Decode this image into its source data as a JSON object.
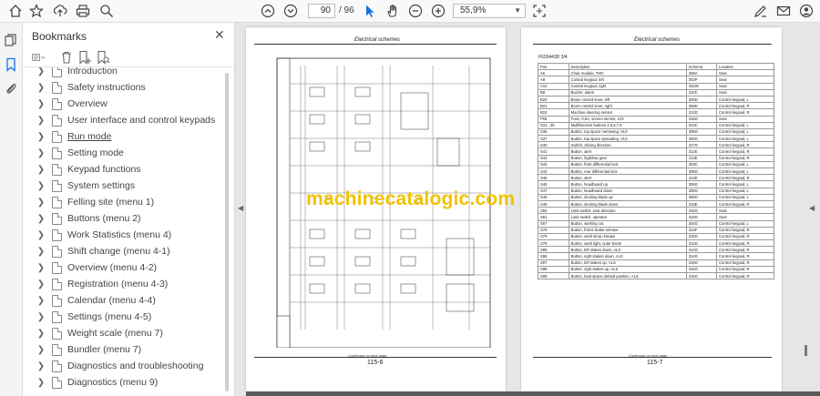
{
  "toolbar": {
    "current_page": "90",
    "total_pages": "/ 96",
    "zoom": "55,9%",
    "icons": [
      "home-icon",
      "bookmark-star-icon",
      "upload-icon",
      "print-icon",
      "search-icon",
      "page-up-icon",
      "page-down-icon",
      "select-cursor-icon",
      "hand-icon",
      "zoom-out-icon",
      "zoom-in-icon",
      "fit-page-icon",
      "sign-icon",
      "email-icon",
      "account-icon"
    ]
  },
  "sidebar": {
    "title": "Bookmarks",
    "items": [
      {
        "label": "Introduction"
      },
      {
        "label": "Safety instructions"
      },
      {
        "label": "Overview"
      },
      {
        "label": "User interface and control keypads"
      },
      {
        "label": "Run mode"
      },
      {
        "label": "Setting mode"
      },
      {
        "label": "Keypad functions"
      },
      {
        "label": "System settings"
      },
      {
        "label": "Felling site (menu 1)"
      },
      {
        "label": "Buttons (menu 2)"
      },
      {
        "label": "Work Statistics (menu 4)"
      },
      {
        "label": "Shift change (menu 4-1)"
      },
      {
        "label": "Overview (menu 4-2)"
      },
      {
        "label": "Registration (menu 4-3)"
      },
      {
        "label": "Calendar (menu 4-4)"
      },
      {
        "label": "Settings (menu 4-5)"
      },
      {
        "label": "Weight scale (menu 7)"
      },
      {
        "label": "Bundler (menu 7)"
      },
      {
        "label": "Diagnostics and troubleshooting"
      },
      {
        "label": "Diagnostics (menu 9)"
      }
    ]
  },
  "document": {
    "left_page": {
      "header": "Electrical schemes",
      "page_number": "115-6",
      "footer_note": "Continued on next page",
      "code": "F626443D 1/4"
    },
    "right_page": {
      "header": "Electrical schemes",
      "page_number": "115-7",
      "footer_note": "Continued on next page",
      "table_title": "F626443D 3/4",
      "columns": [
        "Pos",
        "Description",
        "Schema",
        "Location"
      ],
      "rows": [
        [
          "A6",
          "Chair module, TMC",
          "309A",
          "Seat"
        ],
        [
          "A9",
          "Control keypad, left",
          "302P",
          "Seat"
        ],
        [
          "A10",
          "Control keypad, right",
          "302W",
          "Seat"
        ],
        [
          "B9",
          "Buzzer, alarm",
          "310C",
          "Seat"
        ],
        [
          "B20",
          "Boom control lever, left",
          "306D",
          "Control keypad, L"
        ],
        [
          "B21",
          "Boom control lever, right",
          "306D",
          "Control keypad, R"
        ],
        [
          "B22",
          "Machine steering sensor",
          "313G",
          "Control keypad, R"
        ],
        [
          "F56",
          "Fuse, 0,5A, screen sensor, 12V",
          "316G",
          "Seat"
        ],
        [
          "S31...35",
          "Multifunction buttons 4,5,6,7,8",
          "313C",
          "Control keypad, L"
        ],
        [
          "S36",
          "Button, top space narrowing, VL0",
          "306G",
          "Control keypad, L"
        ],
        [
          "S37",
          "Button, top space spreading, VL0",
          "306G",
          "Control keypad, L"
        ],
        [
          "S40",
          "Switch, driving direction",
          "317G",
          "Control keypad, R"
        ],
        [
          "S41",
          "Button, alert",
          "312E",
          "Control keypad, R"
        ],
        [
          "S42",
          "Button, high/low gear",
          "313E",
          "Control keypad, R"
        ],
        [
          "S43",
          "Button, front differential lock",
          "303C",
          "Control keypad, L"
        ],
        [
          "S44",
          "Button, rear differential lock",
          "306G",
          "Control keypad, L"
        ],
        [
          "S45",
          "Button, alert",
          "314E",
          "Control keypad, R"
        ],
        [
          "S46",
          "Button, headboard up",
          "306G",
          "Control keypad, L"
        ],
        [
          "S47",
          "Button, headboard down",
          "306G",
          "Control keypad, L"
        ],
        [
          "S48",
          "Button, decking blade up",
          "306G",
          "Control keypad, L"
        ],
        [
          "S49",
          "Button, decking blade down",
          "313E",
          "Control keypad, R"
        ],
        [
          "S50",
          "Limit switch, seat direction",
          "316G",
          "Seat"
        ],
        [
          "S51",
          "Limit switch, operator",
          "316G",
          "Seat"
        ],
        [
          "S57",
          "Button, working cor.",
          "304G",
          "Control keypad, L"
        ],
        [
          "S78",
          "Button, frame brake release",
          "314F",
          "Control keypad, R"
        ],
        [
          "S79",
          "Button, work lamp release",
          "316G",
          "Control keypad, R"
        ],
        [
          "S79",
          "Button, work light, outer boom",
          "314G",
          "Control keypad, R"
        ],
        [
          "S95",
          "Button, left stakes down, ALS",
          "314G",
          "Control keypad, R"
        ],
        [
          "S96",
          "Button, right stakes down, ALS",
          "314G",
          "Control keypad, R"
        ],
        [
          "S97",
          "Button, left stakes up, ALS",
          "316G",
          "Control keypad, R"
        ],
        [
          "S98",
          "Button, right stakes up, ALS",
          "316G",
          "Control keypad, R"
        ],
        [
          "S99",
          "Button, load space default position, ALS",
          "316G",
          "Control keypad, R"
        ]
      ]
    },
    "watermark": "machinecatalogic.com"
  }
}
